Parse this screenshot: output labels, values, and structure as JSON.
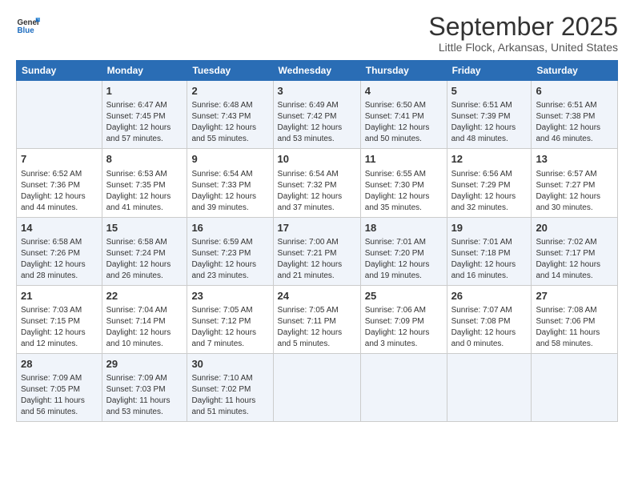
{
  "logo": {
    "general": "General",
    "blue": "Blue"
  },
  "title": "September 2025",
  "location": "Little Flock, Arkansas, United States",
  "weekdays": [
    "Sunday",
    "Monday",
    "Tuesday",
    "Wednesday",
    "Thursday",
    "Friday",
    "Saturday"
  ],
  "weeks": [
    [
      {
        "day": "",
        "content": ""
      },
      {
        "day": "1",
        "content": "Sunrise: 6:47 AM\nSunset: 7:45 PM\nDaylight: 12 hours\nand 57 minutes."
      },
      {
        "day": "2",
        "content": "Sunrise: 6:48 AM\nSunset: 7:43 PM\nDaylight: 12 hours\nand 55 minutes."
      },
      {
        "day": "3",
        "content": "Sunrise: 6:49 AM\nSunset: 7:42 PM\nDaylight: 12 hours\nand 53 minutes."
      },
      {
        "day": "4",
        "content": "Sunrise: 6:50 AM\nSunset: 7:41 PM\nDaylight: 12 hours\nand 50 minutes."
      },
      {
        "day": "5",
        "content": "Sunrise: 6:51 AM\nSunset: 7:39 PM\nDaylight: 12 hours\nand 48 minutes."
      },
      {
        "day": "6",
        "content": "Sunrise: 6:51 AM\nSunset: 7:38 PM\nDaylight: 12 hours\nand 46 minutes."
      }
    ],
    [
      {
        "day": "7",
        "content": "Sunrise: 6:52 AM\nSunset: 7:36 PM\nDaylight: 12 hours\nand 44 minutes."
      },
      {
        "day": "8",
        "content": "Sunrise: 6:53 AM\nSunset: 7:35 PM\nDaylight: 12 hours\nand 41 minutes."
      },
      {
        "day": "9",
        "content": "Sunrise: 6:54 AM\nSunset: 7:33 PM\nDaylight: 12 hours\nand 39 minutes."
      },
      {
        "day": "10",
        "content": "Sunrise: 6:54 AM\nSunset: 7:32 PM\nDaylight: 12 hours\nand 37 minutes."
      },
      {
        "day": "11",
        "content": "Sunrise: 6:55 AM\nSunset: 7:30 PM\nDaylight: 12 hours\nand 35 minutes."
      },
      {
        "day": "12",
        "content": "Sunrise: 6:56 AM\nSunset: 7:29 PM\nDaylight: 12 hours\nand 32 minutes."
      },
      {
        "day": "13",
        "content": "Sunrise: 6:57 AM\nSunset: 7:27 PM\nDaylight: 12 hours\nand 30 minutes."
      }
    ],
    [
      {
        "day": "14",
        "content": "Sunrise: 6:58 AM\nSunset: 7:26 PM\nDaylight: 12 hours\nand 28 minutes."
      },
      {
        "day": "15",
        "content": "Sunrise: 6:58 AM\nSunset: 7:24 PM\nDaylight: 12 hours\nand 26 minutes."
      },
      {
        "day": "16",
        "content": "Sunrise: 6:59 AM\nSunset: 7:23 PM\nDaylight: 12 hours\nand 23 minutes."
      },
      {
        "day": "17",
        "content": "Sunrise: 7:00 AM\nSunset: 7:21 PM\nDaylight: 12 hours\nand 21 minutes."
      },
      {
        "day": "18",
        "content": "Sunrise: 7:01 AM\nSunset: 7:20 PM\nDaylight: 12 hours\nand 19 minutes."
      },
      {
        "day": "19",
        "content": "Sunrise: 7:01 AM\nSunset: 7:18 PM\nDaylight: 12 hours\nand 16 minutes."
      },
      {
        "day": "20",
        "content": "Sunrise: 7:02 AM\nSunset: 7:17 PM\nDaylight: 12 hours\nand 14 minutes."
      }
    ],
    [
      {
        "day": "21",
        "content": "Sunrise: 7:03 AM\nSunset: 7:15 PM\nDaylight: 12 hours\nand 12 minutes."
      },
      {
        "day": "22",
        "content": "Sunrise: 7:04 AM\nSunset: 7:14 PM\nDaylight: 12 hours\nand 10 minutes."
      },
      {
        "day": "23",
        "content": "Sunrise: 7:05 AM\nSunset: 7:12 PM\nDaylight: 12 hours\nand 7 minutes."
      },
      {
        "day": "24",
        "content": "Sunrise: 7:05 AM\nSunset: 7:11 PM\nDaylight: 12 hours\nand 5 minutes."
      },
      {
        "day": "25",
        "content": "Sunrise: 7:06 AM\nSunset: 7:09 PM\nDaylight: 12 hours\nand 3 minutes."
      },
      {
        "day": "26",
        "content": "Sunrise: 7:07 AM\nSunset: 7:08 PM\nDaylight: 12 hours\nand 0 minutes."
      },
      {
        "day": "27",
        "content": "Sunrise: 7:08 AM\nSunset: 7:06 PM\nDaylight: 11 hours\nand 58 minutes."
      }
    ],
    [
      {
        "day": "28",
        "content": "Sunrise: 7:09 AM\nSunset: 7:05 PM\nDaylight: 11 hours\nand 56 minutes."
      },
      {
        "day": "29",
        "content": "Sunrise: 7:09 AM\nSunset: 7:03 PM\nDaylight: 11 hours\nand 53 minutes."
      },
      {
        "day": "30",
        "content": "Sunrise: 7:10 AM\nSunset: 7:02 PM\nDaylight: 11 hours\nand 51 minutes."
      },
      {
        "day": "",
        "content": ""
      },
      {
        "day": "",
        "content": ""
      },
      {
        "day": "",
        "content": ""
      },
      {
        "day": "",
        "content": ""
      }
    ]
  ]
}
